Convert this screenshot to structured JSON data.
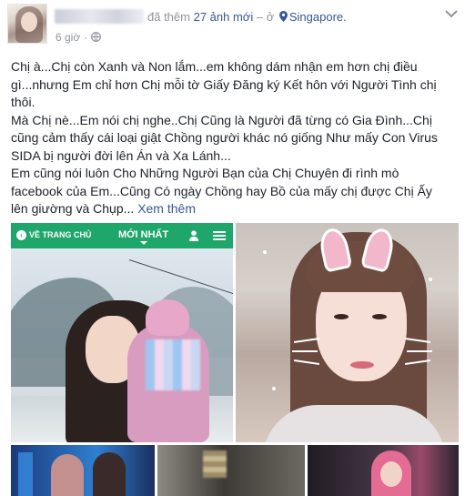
{
  "header": {
    "action_text": "đã thêm",
    "photo_count_link": "27 ảnh mới",
    "at_text": "– ở",
    "location_link": "Singapore.",
    "time": "6 giờ",
    "dot": "·"
  },
  "post": {
    "lines": [
      "Chị à...Chị còn Xanh và Non lắm...em không dám nhận em hơn chị điều",
      "gì...nhưng Em chỉ hơn Chị mỗi tờ Giấy Đăng ký Kết hôn với Người Tình chị",
      "thôi.",
      "Mà Chị nè...Em nói chị nghe..Chị Cũng là Người đã từng có Gia Đình...Chị",
      "cũng cảm thấy cái loại giật Chồng người khác nó giống Như mấy Con Virus",
      "SIDA bị người đời lên Án và Xa Lánh...",
      "Em cũng nói luôn Cho Những Người Bạn của Chị Chuyên đi rình mò",
      "facebook của Em...Cũng Có ngày Chồng hay Bồ của mấy chị được Chị Ấy",
      "lên giường và Chụp..."
    ],
    "see_more": "Xem thêm"
  },
  "app_bar": {
    "back_label": "VỀ TRANG CHỦ",
    "back_icon": "chevron-left-icon",
    "tab_label": "MỚI NHẤT",
    "user_icon": "user-icon",
    "menu_icon": "menu-icon",
    "color": "#1fa66a"
  },
  "colors": {
    "link": "#365899",
    "meta": "#90949c",
    "text": "#1d2129"
  }
}
